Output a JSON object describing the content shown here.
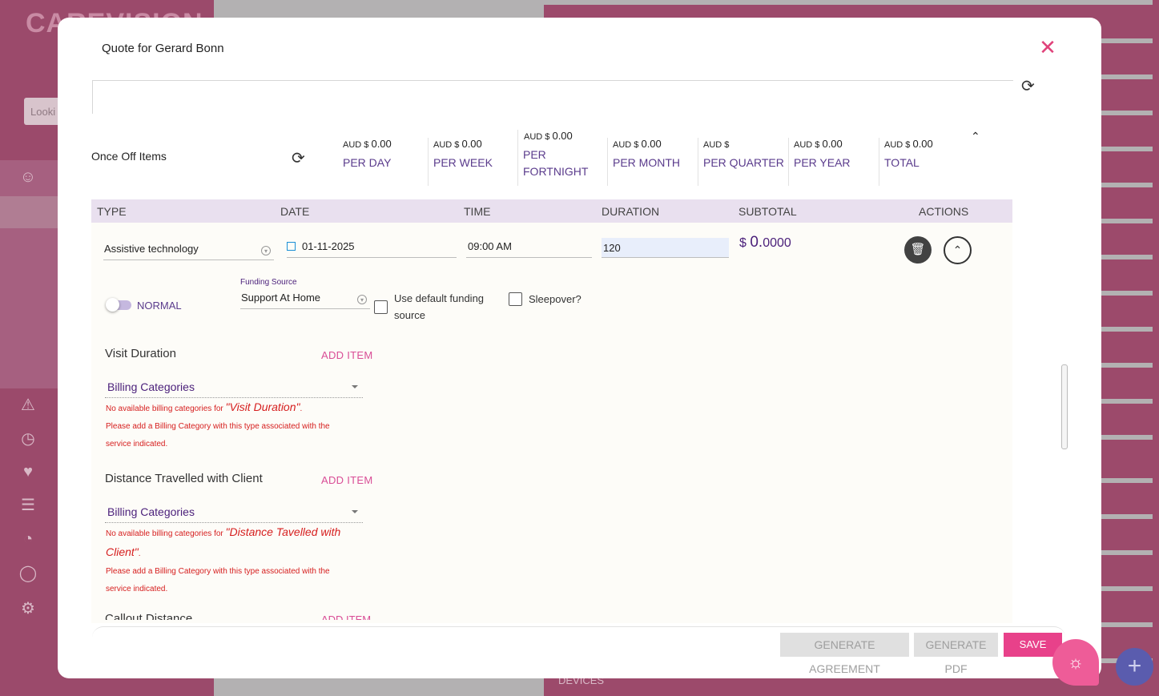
{
  "background": {
    "logo": "CAREVISION",
    "search_placeholder": "Looki",
    "bottom_label": "DEVICES"
  },
  "modal": {
    "title": "Quote for Gerard Bonn",
    "summary": {
      "label": "Once Off Items",
      "stats": [
        {
          "currency": "AUD $",
          "value": "0.00",
          "label": "PER DAY"
        },
        {
          "currency": "AUD $",
          "value": "0.00",
          "label": "PER WEEK"
        },
        {
          "currency": "AUD $",
          "value": "0.00",
          "label": "PER FORTNIGHT"
        },
        {
          "currency": "AUD $",
          "value": "0.00",
          "label": "PER MONTH"
        },
        {
          "currency": "AUD $",
          "value": "",
          "label": "PER QUARTER"
        },
        {
          "currency": "AUD $",
          "value": "0.00",
          "label": "PER YEAR"
        },
        {
          "currency": "AUD $",
          "value": "0.00",
          "label": "TOTAL"
        }
      ]
    },
    "table": {
      "headers": [
        "TYPE",
        "DATE",
        "TIME",
        "DURATION",
        "SUBTOTAL",
        "ACTIONS"
      ],
      "row": {
        "type": "Assistive technology",
        "date": "01-11-2025",
        "time": "09:00 AM",
        "duration": "120",
        "subtotal_currency": "$",
        "subtotal_int": "0.",
        "subtotal_dec": "0000",
        "mode_label": "NORMAL",
        "funding_label": "Funding Source",
        "funding_value": "Support At Home",
        "default_funding_label": "Use default funding source",
        "sleepover_label": "Sleepover?"
      }
    },
    "sections": [
      {
        "title": "Visit Duration",
        "add_label": "ADD ITEM",
        "select_label": "Billing Categories",
        "err_prefix": "No available billing categories for ",
        "err_name": "\"Visit Duration\"",
        "err_suffix": ".",
        "err_hint_1": "Please add a Billing Category with this type associated with the",
        "err_hint_2": "service indicated."
      },
      {
        "title": "Distance Travelled with Client",
        "add_label": "ADD ITEM",
        "select_label": "Billing Categories",
        "err_prefix": "No available billing categories for ",
        "err_name_1": "\"Distance Tavelled with",
        "err_name_2": "Client\"",
        "err_suffix": ".",
        "err_hint_1": "Please add a Billing Category with this type associated with the",
        "err_hint_2": "service indicated."
      },
      {
        "title": "Callout Distance",
        "add_label": "ADD ITEM"
      }
    ],
    "footer": {
      "generate_agreement": "GENERATE AGREEMENT",
      "generate_pdf": "GENERATE PDF",
      "save": "SAVE"
    }
  },
  "colors": {
    "accent_pink": "#e8418a",
    "purple": "#4a1f7a",
    "error": "#d61e1e",
    "header_bg": "#e9e0ef"
  },
  "icons": [
    "close-icon",
    "refresh-icon",
    "chevron-up-icon",
    "calendar-icon",
    "delete-icon",
    "collapse-icon",
    "lightbulb-icon",
    "plus-icon"
  ]
}
